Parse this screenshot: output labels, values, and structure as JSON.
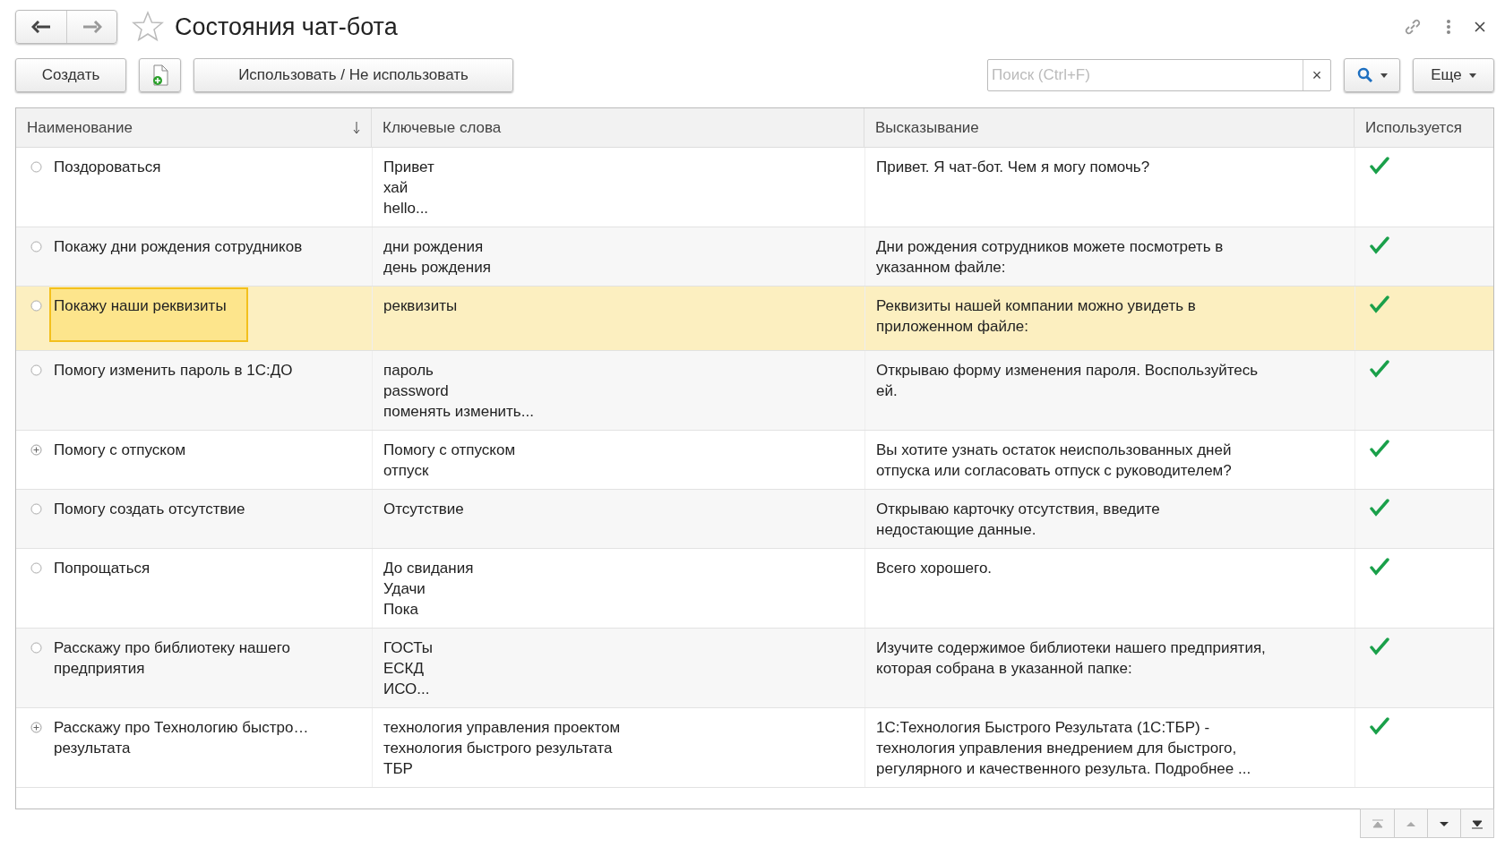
{
  "window": {
    "title": "Состояния чат-бота",
    "favorite": false
  },
  "toolbar": {
    "create": "Создать",
    "toggle": "Использовать / Не использовать",
    "search": {
      "placeholder": "Поиск (Ctrl+F)",
      "clear": "×"
    },
    "more": "Еще"
  },
  "table": {
    "columns": [
      {
        "label": "Наименование",
        "sorted": true
      },
      {
        "label": "Ключевые слова"
      },
      {
        "label": "Высказывание"
      },
      {
        "label": "Используется"
      }
    ],
    "rows": [
      {
        "kind": "item",
        "name": "Поздороваться",
        "keywords": [
          "Привет",
          "хай",
          "hello..."
        ],
        "phrase": "Привет. Я чат-бот. Чем я могу помочь?",
        "used": true,
        "selected": false
      },
      {
        "kind": "item",
        "name": "Покажу дни рождения сотрудников",
        "keywords": [
          "дни рождения",
          "день рождения"
        ],
        "phrase": "Дни рождения сотрудников можете посмотреть в\nуказанном файле:",
        "used": true,
        "selected": false
      },
      {
        "kind": "item",
        "name": "Покажу наши реквизиты",
        "keywords": [
          "реквизиты"
        ],
        "phrase": "Реквизиты нашей компании можно увидеть в\nприложенном файле:",
        "used": true,
        "selected": true
      },
      {
        "kind": "item",
        "name": "Помогу изменить пароль в 1С:ДО",
        "keywords": [
          "пароль",
          "password",
          "поменять изменить..."
        ],
        "phrase": "Открываю форму изменения пароля. Воспользуйтесь\nей.",
        "used": true,
        "selected": false
      },
      {
        "kind": "group",
        "name": "Помогу с отпуском",
        "keywords": [
          "Помогу с отпуском",
          "отпуск"
        ],
        "phrase": "Вы хотите узнать остаток неиспользованных дней\nотпуска или согласовать отпуск с руководителем?",
        "used": true,
        "selected": false
      },
      {
        "kind": "item",
        "name": "Помогу создать отсутствие",
        "keywords": [
          "Отсутствие"
        ],
        "phrase": "Открываю карточку отсутствия, введите\nнедостающие данные.",
        "used": true,
        "selected": false
      },
      {
        "kind": "item",
        "name": "Попрощаться",
        "keywords": [
          "До свидания",
          "Удачи",
          "Пока"
        ],
        "phrase": "Всего хорошего.",
        "used": true,
        "selected": false
      },
      {
        "kind": "item",
        "name": "Расскажу про библиотеку нашего\nпредприятия",
        "keywords": [
          "ГОСТы",
          "ЕСКД",
          "ИСО..."
        ],
        "phrase": "Изучите содержимое библиотеки нашего предприятия,\nкоторая собрана в указанной папке:",
        "used": true,
        "selected": false
      },
      {
        "kind": "group",
        "name": "Расскажу про Технологию быстро…\nрезультата",
        "keywords": [
          "технология управления проектом",
          "технология быстрого результата",
          "ТБР"
        ],
        "phrase": "1С:Технология Быстрого Результата (1С:ТБР) -\nтехнология управления внедрением для быстрого,\nрегулярного и качественного результа. Подробнее ...",
        "used": true,
        "selected": false
      }
    ]
  }
}
